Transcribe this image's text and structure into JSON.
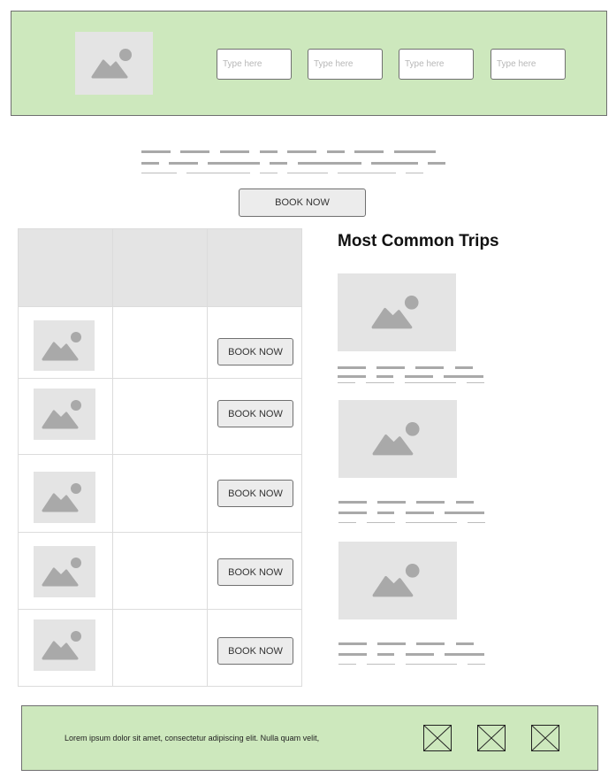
{
  "header": {
    "inputs": [
      {
        "placeholder": "Type here"
      },
      {
        "placeholder": "Type here"
      },
      {
        "placeholder": "Type here"
      },
      {
        "placeholder": "Type here"
      }
    ]
  },
  "hero": {
    "book_label": "BOOK NOW"
  },
  "trips_table": {
    "rows": [
      {
        "book_label": "BOOK NOW"
      },
      {
        "book_label": "BOOK NOW"
      },
      {
        "book_label": "BOOK NOW"
      },
      {
        "book_label": "BOOK NOW"
      },
      {
        "book_label": "BOOK NOW"
      }
    ]
  },
  "sidebar": {
    "title": "Most Common Trips"
  },
  "footer": {
    "text": "Lorem ipsum dolor sit amet, consectetur adipiscing elit. Nulla quam velit,"
  },
  "icons": {
    "image_placeholder": "image-placeholder-icon",
    "social_placeholder": "x-box-icon"
  },
  "colors": {
    "header_bg": "#cde8bd",
    "placeholder_bg": "#e4e4e4",
    "placeholder_glyph": "#a9a9a9",
    "button_bg": "#ececec"
  }
}
